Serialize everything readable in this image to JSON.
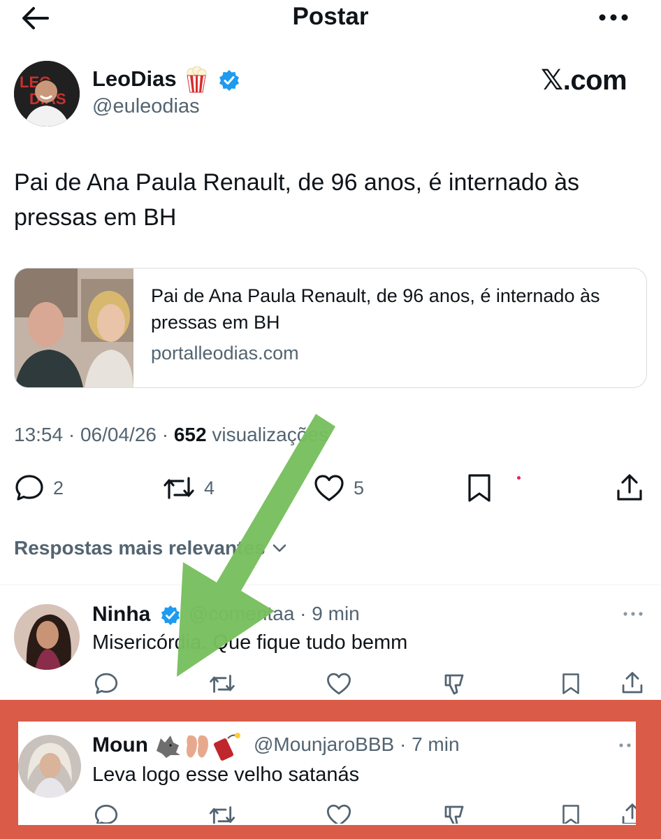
{
  "header": {
    "title": "Postar",
    "back_icon": "arrow-left-icon",
    "more_icon": "more-horizontal-icon"
  },
  "post": {
    "author_name": "LeoDias",
    "author_handle": "@euleodias",
    "watermark": "𝕏.com",
    "text": "Pai de Ana Paula Renault, de 96 anos, é internado às pressas em BH",
    "card": {
      "title": "Pai de Ana Paula Renault, de 96 anos, é internado às pressas em BH",
      "domain": "portalleodias.com"
    },
    "time": "13:54",
    "date": "06/04/26",
    "views_count": "652",
    "views_label": "visualizações",
    "actions": {
      "replies": "2",
      "reposts": "4",
      "likes": "5"
    }
  },
  "replies_section": {
    "label": "Respostas mais relevantes"
  },
  "replies": [
    {
      "name": "Ninha",
      "handle": "@comentaa",
      "time": "9 min",
      "text": "Misericórdia. Que fique tudo bemm"
    },
    {
      "name": "Moun",
      "handle": "@MounjaroBBB",
      "time": "7 min",
      "text": "Leva logo esse velho satanás"
    }
  ],
  "colors": {
    "verified": "#1d9bf0",
    "annotation_red": "#d95b48",
    "arrow_green": "#78bf5f",
    "secondary_text": "#536471"
  }
}
